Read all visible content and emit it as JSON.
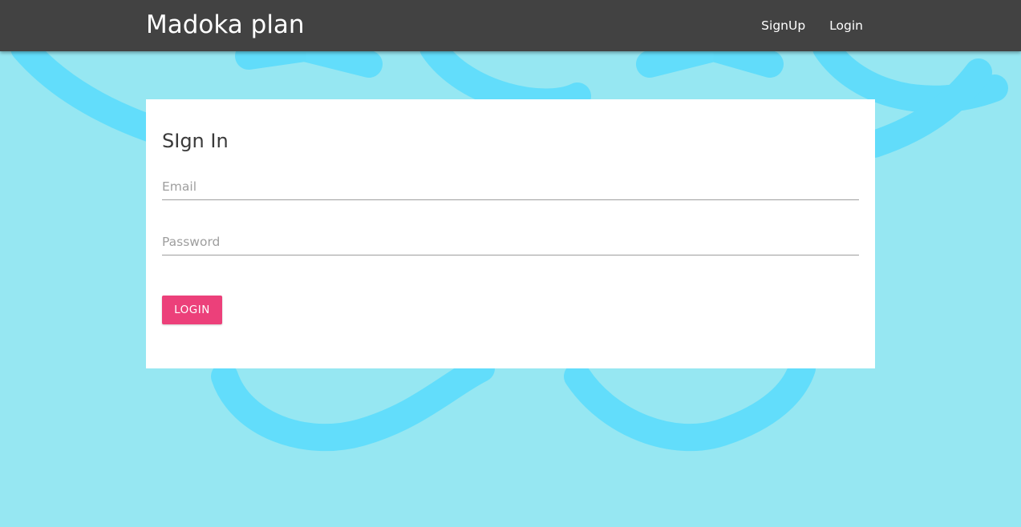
{
  "navbar": {
    "brand": "Madoka plan",
    "links": [
      {
        "label": "SignUp"
      },
      {
        "label": "Login"
      }
    ]
  },
  "signin": {
    "title": "SIgn In",
    "email_placeholder": "Email",
    "email_value": "",
    "password_placeholder": "Password",
    "password_value": "",
    "button_label": "Login"
  },
  "colors": {
    "navbar": "#424242",
    "background": "#96e7f2",
    "background_art": "#5fdcfb",
    "card": "#ffffff",
    "button": "#ec407a"
  }
}
